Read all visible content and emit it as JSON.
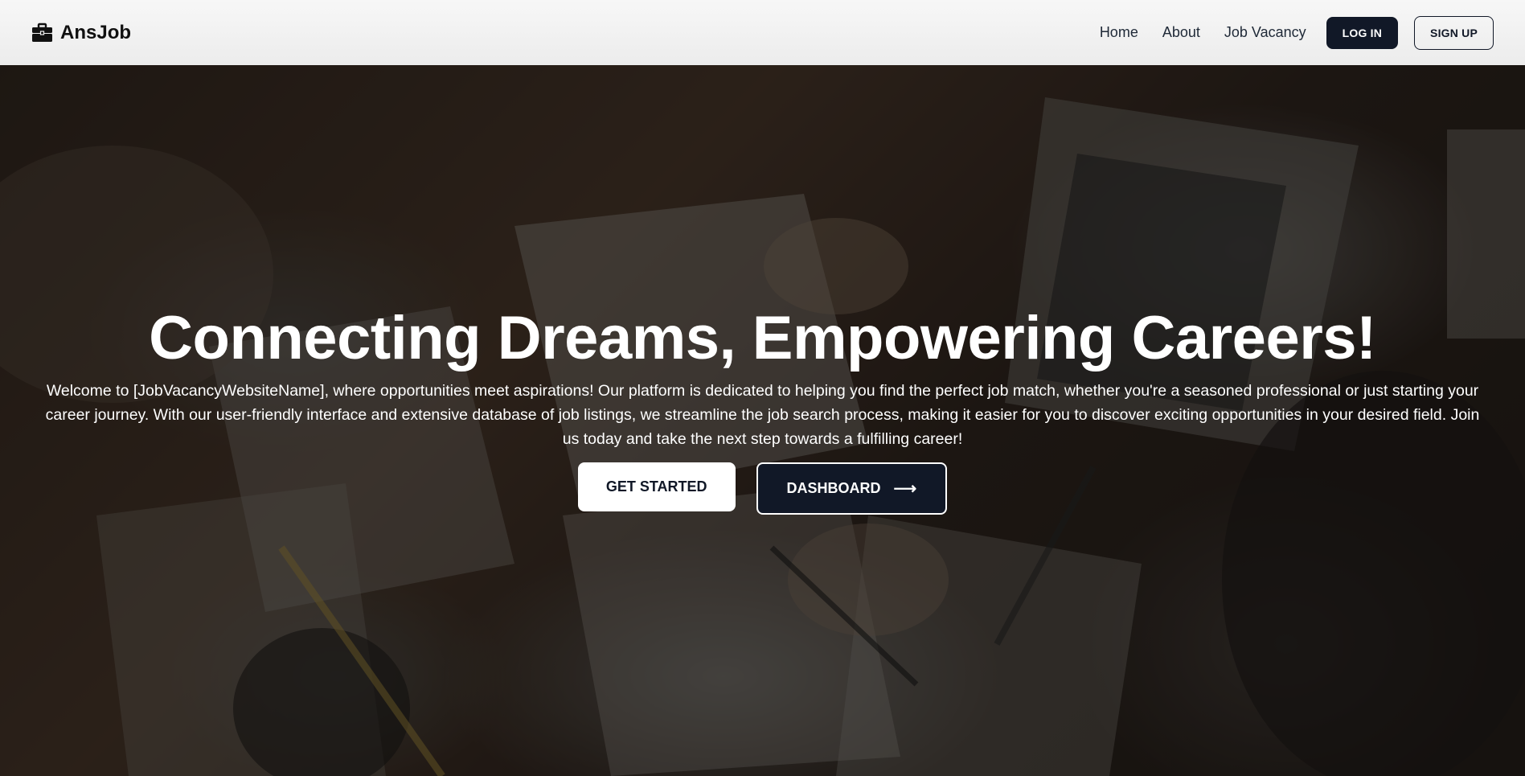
{
  "brand": {
    "name": "AnsJob",
    "icon": "briefcase-icon"
  },
  "nav": {
    "links": [
      "Home",
      "About",
      "Job Vacancy"
    ],
    "login_label": "LOG IN",
    "signup_label": "SIGN UP"
  },
  "hero": {
    "title": "Connecting Dreams, Empowering Careers!",
    "description": "Welcome to [JobVacancyWebsiteName], where opportunities meet aspirations! Our platform is dedicated to helping you find the perfect job match, whether you're a seasoned professional or just starting your career journey. With our user-friendly interface and extensive database of job listings, we streamline the job search process, making it easier for you to discover exciting opportunities in your desired field. Join us today and take the next step towards a fulfilling career!",
    "get_started_label": "GET STARTED",
    "dashboard_label": "DASHBOARD",
    "dashboard_icon": "arrow-right-icon"
  },
  "colors": {
    "navbar_bg": "#f2f2f2",
    "primary_dark": "#111827",
    "hero_text": "#ffffff"
  }
}
